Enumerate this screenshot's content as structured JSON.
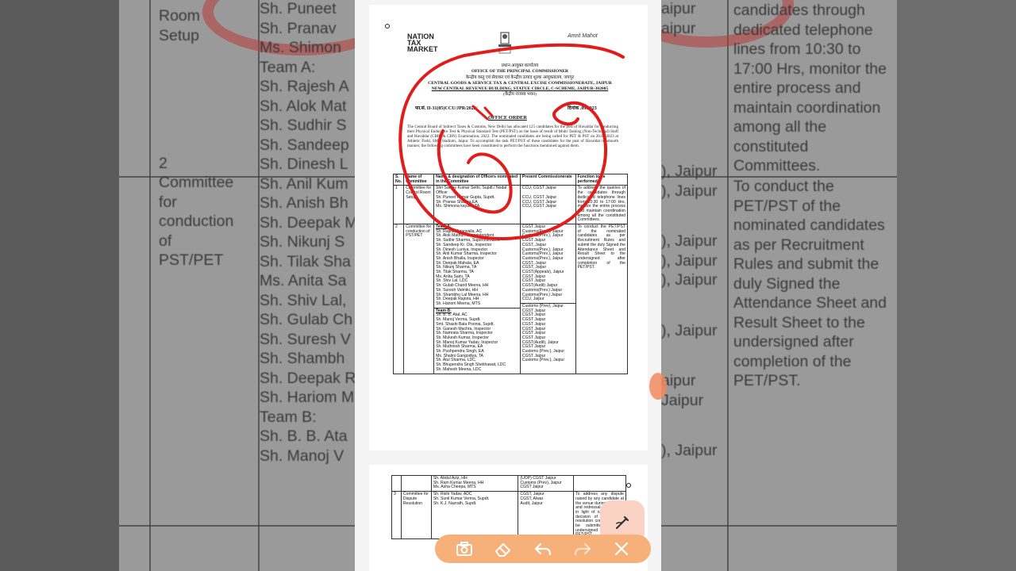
{
  "background": {
    "left_column": [
      "Room",
      "Setup",
      "",
      "",
      "",
      "",
      "",
      "",
      "",
      "2",
      "Committee",
      "for",
      "conduction",
      "of",
      "PST/PET"
    ],
    "names_column": [
      "Sh. Puneet",
      "Sh. Pranav",
      "Ms. Shimon",
      "Team A:",
      "Sh. Rajesh A",
      "Sh. Alok Mat",
      "Sh. Sudhir S",
      "Sh. Sandeep",
      "Sh. Dinesh L",
      "Sh. Anil Kum",
      "Sh. Anish Bh",
      "Sh. Deepak M",
      "Sh. Nikunj S",
      "Sh. Tilak Sha",
      "Ms. Anita Sa",
      "Sh. Shiv Lal,",
      "Sh. Gulab Ch",
      "Sh. Suresh V",
      "Sh. Shambh",
      "Sh. Deepak R",
      "Sh. Hariom M",
      "Team B:",
      "Sh. B. B. Ata",
      "Sh. Manoj V"
    ],
    "commissionerate_column": [
      "aipur",
      "aipur",
      "",
      "",
      "",
      "",
      "",
      "",
      "",
      "",
      "), Jaipur",
      "), Jaipur",
      "",
      "",
      "), Jaipur",
      "), Jaipur",
      "), Jaipur",
      "",
      "",
      "), Jaipur",
      "",
      "",
      "aipur",
      "Jaipur",
      "",
      "",
      "), Jaipur"
    ],
    "function_top": [
      "candidates through",
      "dedicated telephone",
      "lines from 10:30 to",
      "17:00 Hrs, monitor the",
      "entire process and",
      "maintain coordination",
      "among all the",
      "constituted",
      "Committees."
    ],
    "function_team": [
      "To conduct the",
      "PET/PST of the",
      "nominated candidates",
      "as per Recruitment",
      "Rules and submit the",
      "duly Signed the",
      "Attendance Sheet and",
      "Result Sheet to the",
      "undersigned after",
      "completion of the",
      "PET/PST."
    ]
  },
  "document": {
    "logo_left": [
      "NATION",
      "TAX",
      "MARKET"
    ],
    "logo_right": "Amrit Mahot",
    "header_lines": [
      "प्रधान आयुक्त कार्यालय",
      "OFFICE OF THE PRINCIPAL COMMISSIONER",
      "केन्द्रीय वस्तु एवं सेवाकर एवं केन्द्रीय उत्पाद शुल्क आयुक्तालय, जयपुर",
      "CENTRAL GOODS & SERVICE TAX & CENTRAL EXCISE COMMISSIONERATE, JAIPUR",
      "NEW CENTRAL REVENUE BUILDING, STATUE CIRCLE, C-SCHEME, JAIPUR-302005",
      "(केंद्रीय राजस्व भवन)"
    ],
    "ref": "फा.सं. II-31(05)CCU/JPR/2022/",
    "date": "दिनांक .09.2023",
    "order_title": "OFFICE ORDER",
    "paragraph": "The Central Board of Indirect Taxes & Customs, New Delhi has allocated 125 candidates for the post of Havaldar for conducting their Physical Endurance Test & Physical Standard Test (PET/PST) on the basis of result of Multi Tasking (Non-Technical) Staff and Havaldar (CBIC & CBN) Examination, 2022. The nominated candidates are being called for PET & PST on 26.09.2023 at Athletic Field, SMS Stadium, Jaipur. To accomplish the task PET/PST of these candidates for the post of Havaldar in smooth manner, the following committees have been constituted to perform the functions mentioned against them.",
    "table_headers": [
      "S. No.",
      "Name of Committee",
      "Name & designation of Officers nominated in the Committee",
      "Present Commissionerate",
      "Function to be performed"
    ],
    "rows": [
      {
        "no": "1",
        "committee": "Committee for Control Room Setup",
        "officers": [
          "Shri Sanjay Kumar Sethi, Supdt./ Nodal Officer",
          "Sh. Puneet Kumar Gupta, Supdt.",
          "Sh. Pranav Sharma,EA",
          "Ms. Shimona kayath, TA"
        ],
        "commissionerate": [
          "CCU, CGST Jaipur",
          "",
          "CCU, CGST Jaipur",
          "CCU, CGST Jaipur",
          "CCU, CGST Jaipur"
        ],
        "function": "To address the queries of the candidates through dedicated telephone lines from 10:30 to 17:00 Hrs, monitor the entire process and maintain coordination among all the constituted Committees."
      },
      {
        "no": "2",
        "committee": "Committee for conduction of PST/PET",
        "team_a_label": "Team A:",
        "team_a": [
          "Sh. Rajesh Agarwalla, AC",
          "Sh. Alok Mathur, Superintendent",
          "Sh. Sudhir Sharma, Superintendent",
          "Sh. Sandeep Kr. Ola, Inspector",
          "Sh. Dinesh Luniya, Inspector",
          "Sh. Anil Kumar Sharma, Inspector",
          "Sh. Anish Bhalla, Inspector",
          "Sh. Deepak Mahala, EA",
          "Sh. Nikunj Sharma, TA",
          "Sh. Tilak Sharma, TA",
          "Ms. Anita Saini, TA",
          "Sh. Shiv Lal, LDC",
          "Sh. Gulab Chand Meena, HH",
          "Sh. Suresh Valmiki, HH",
          "Sh. Shambhu Lal Meena, HH",
          "Sh. Deepak Rajoria, HH",
          "Sh. Hariom Meena, MTS"
        ],
        "team_a_comm": [
          "CGST Jaipur",
          "Customs(Prev.), Jaipur",
          "Customs(Prev.), Jaipur",
          "CGST Jaipur",
          "CGST, Jaipur",
          "Customs(Prev.), Jaipur",
          "Customs(Prev.), Jaipur",
          "Customs(Prev.), Jaipur",
          "CGST, Jaipur",
          "CGST, Jaipur",
          "CGST(Appeals), Jaipur",
          "CGST Jaipur",
          "CGST Jaipur",
          "CGST(Audit) Jaipur",
          "Customs(Prev.) Jaipur",
          "Customs(Prev.) Jaipur",
          "CCU, Jaipur"
        ],
        "team_b_label": "Team B:",
        "team_b": [
          "Sh. B. B. Atal, AC",
          "Sh. Manoj Verma, Supdt.",
          "Smt. Shashi Bala Poonia, Supdt.",
          "Sh. Ganesh Machra, Inspector",
          "Sh. Namrata Sharma, Inspector",
          "Sh. Mukesh Kumar, Inspector",
          "Sh. Manoj Kumar Yadav, Inspector",
          "Sh. Muthresh Sharma, EA",
          "Sh. Pushpendra Singh, EA",
          "Ms. Shalini Gangodiya, TA",
          "Sh. Atul Sharma, LDC",
          "Sh. Bhupendra Singh Shekhawat, LDC",
          "Sh. Mahesh Meena, LDC"
        ],
        "team_b_comm": [
          "Customs (Prev), Jaipur",
          "CGST Jaipur",
          "CGST Jaipur",
          "CGST Jaipur",
          "CGST Jaipur",
          "CGST Jaipur",
          "CGST Jaipur",
          "CGST Jaipur",
          "CGST(Audit), Jaipur",
          "CGST Jaipur",
          "Customs (Prev.), Jaipur",
          "CGST Jaipur",
          "Customs (Prev.), Jaipur"
        ],
        "function": "To conduct the PET/PST of the nominated candidates as per Recruitment Rules and submit the duly Signed the Attendance Sheet and Result Sheet to the undersigned after completion of the PET/PST."
      }
    ]
  },
  "page2": {
    "cont_officers": [
      "Sh. Abdul Aziz, HH",
      "Sh. Ram Kumar Meena, HH",
      "Ms. Asha Cheepa, MTS"
    ],
    "cont_comm": [
      "(UOP) CGST Jaipur",
      "Customs (Prev), Jaipur",
      "CGST Jaipur"
    ],
    "row3_no": "3",
    "row3_committee": "Committee for Dispute Resolution",
    "row3_officers": [
      "Sh. Rishi Yadav, ADC",
      "Sh. Sunil Kumar Verma, Supdt.",
      "Sh. K.J. Nazrath, Supdt."
    ],
    "row3_comm": [
      "CGST, Jaipur",
      "CGST, Alwar",
      "Audit, Jaipur"
    ],
    "row3_function": "To address any dispute raised by any candidate at the venue during PET/PST and redressal of the same in light of rules and the decision of the dispute resolution committee shall be submitted to the undersigned after of PET/PST."
  },
  "toolbar": {
    "buttons": [
      "camera-icon",
      "eraser-icon",
      "undo-icon",
      "redo-icon",
      "close-icon"
    ],
    "pen_button": "pen-icon"
  },
  "colors": {
    "annotation_red": "#e21b1b",
    "toolbar_bg": "#f6b07a",
    "pen_bg": "#fbd3c5"
  }
}
